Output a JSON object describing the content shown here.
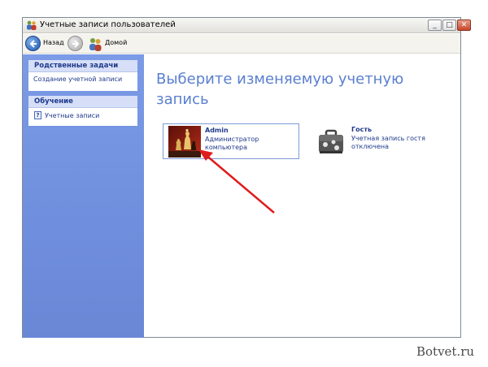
{
  "window": {
    "title": "Учетные записи пользователей",
    "minimize_icon": "minimize-icon",
    "maximize_icon": "maximize-icon",
    "close_icon": "close-icon"
  },
  "toolbar": {
    "back_label": "Назад",
    "home_label": "Домой"
  },
  "sidebar": {
    "related_tasks": {
      "header": "Родственные задачи",
      "items": [
        {
          "label": "Создание учетной записи"
        }
      ]
    },
    "learning": {
      "header": "Обучение",
      "items": [
        {
          "label": "Учетные записи",
          "icon": "help-icon"
        }
      ]
    }
  },
  "main": {
    "title": "Выберите изменяемую учетную запись",
    "accounts": [
      {
        "name": "Admin",
        "description": "Администратор компьютера",
        "picture": "chess-picture"
      },
      {
        "name": "Гость",
        "description": "Учетная запись гостя отключена",
        "picture": "briefcase-picture"
      }
    ]
  },
  "colors": {
    "sidebar": "#7b9be6",
    "heading": "#5a7fcf",
    "link": "#1f3a8c",
    "arrow": "#e01b1b"
  },
  "watermark": {
    "text": "Botvet.ru"
  }
}
